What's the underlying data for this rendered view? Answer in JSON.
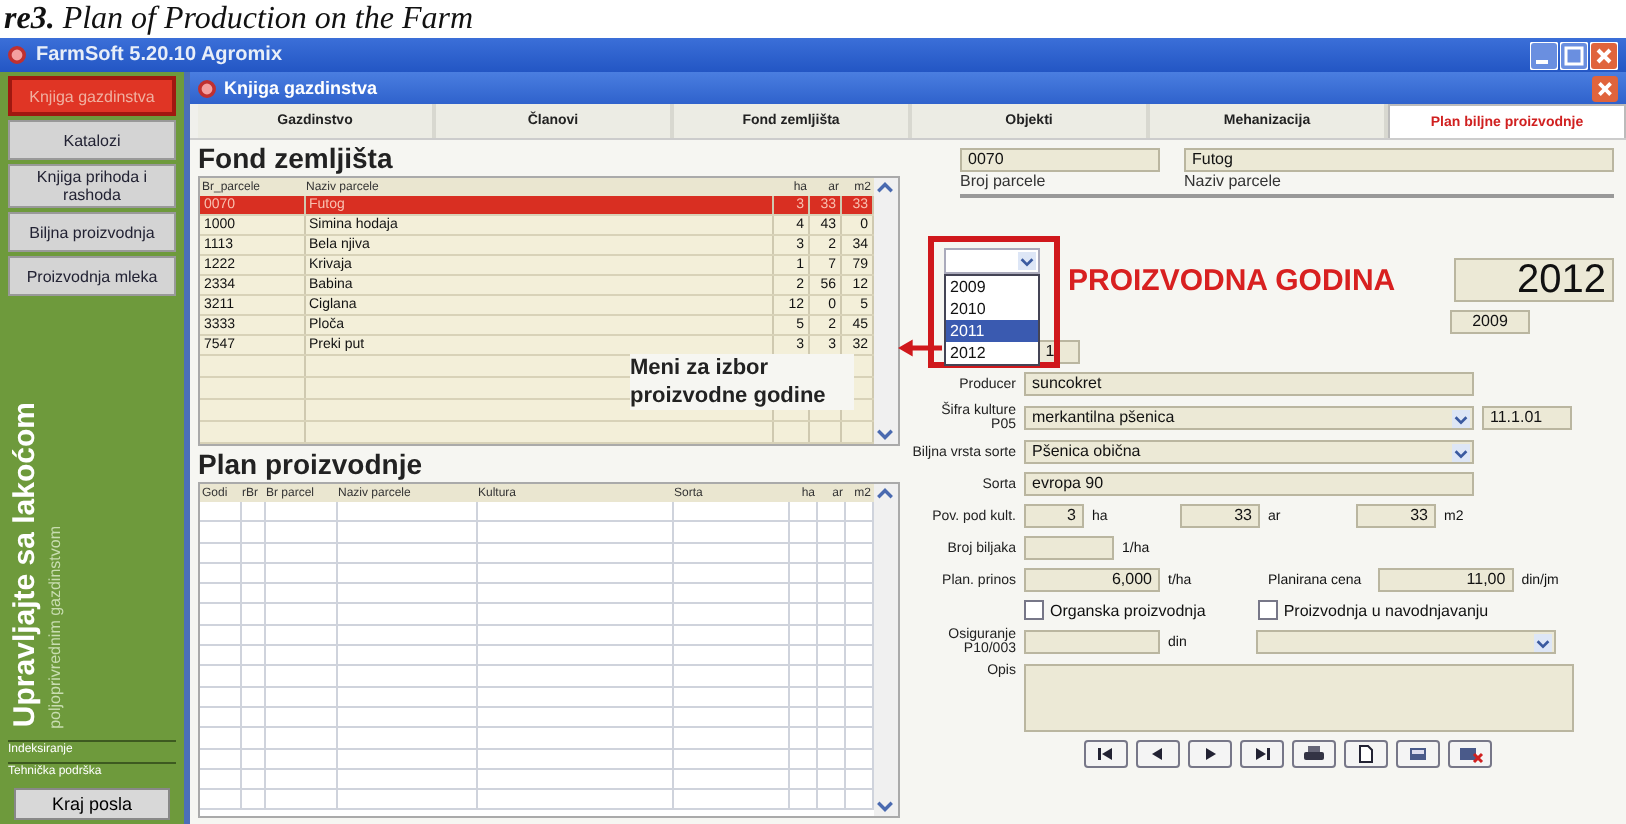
{
  "caption": "**re3.** Plan of Production on the Farm",
  "window": {
    "title": "FarmSoft 5.20.10 Agromix"
  },
  "sidebar": {
    "items": [
      {
        "label": "Knjiga gazdinstva",
        "selected": true
      },
      {
        "label": "Katalozi",
        "selected": false
      },
      {
        "label": "Knjiga prihoda i rashoda",
        "selected": false
      },
      {
        "label": "Biljna proizvodnja",
        "selected": false
      },
      {
        "label": "Proizvodnja mleka",
        "selected": false
      }
    ],
    "slogan": "Upravljajte sa lakoćom",
    "slogan_sub": "poljoprivrednim gazdinstvom",
    "links": [
      "Indeksiranje",
      "Tehnička podrška"
    ],
    "exit_button": "Kraj posla"
  },
  "subwindow": {
    "title": "Knjiga gazdinstva"
  },
  "tabs": [
    {
      "label": "Gazdinstvo",
      "selected": false
    },
    {
      "label": "Članovi",
      "selected": false
    },
    {
      "label": "Fond zemljišta",
      "selected": false
    },
    {
      "label": "Objekti",
      "selected": false
    },
    {
      "label": "Mehanizacija",
      "selected": false
    },
    {
      "label": "Plan biljne proizvodnje",
      "selected": true
    }
  ],
  "land_fund": {
    "heading": "Fond zemljišta",
    "columns": [
      "Br_parcele",
      "Naziv parcele",
      "ha",
      "ar",
      "m2"
    ],
    "rows": [
      {
        "cells": [
          "0070",
          "Futog",
          "3",
          "33",
          "33"
        ],
        "selected": true
      },
      {
        "cells": [
          "1000",
          "Simina hodaja",
          "4",
          "43",
          "0"
        ],
        "selected": false
      },
      {
        "cells": [
          "1113",
          "Bela njiva",
          "3",
          "2",
          "34"
        ],
        "selected": false
      },
      {
        "cells": [
          "1222",
          "Krivaja",
          "1",
          "7",
          "79"
        ],
        "selected": false
      },
      {
        "cells": [
          "2334",
          "Babina",
          "2",
          "56",
          "12"
        ],
        "selected": false
      },
      {
        "cells": [
          "3211",
          "Ciglana",
          "12",
          "0",
          "5"
        ],
        "selected": false
      },
      {
        "cells": [
          "3333",
          "Ploča",
          "5",
          "2",
          "45"
        ],
        "selected": false
      },
      {
        "cells": [
          "7547",
          "Preki put",
          "3",
          "3",
          "32"
        ],
        "selected": false
      }
    ]
  },
  "plan": {
    "heading": "Plan proizvodnje",
    "columns": [
      "Godi",
      "rBr",
      "Br parcel",
      "Naziv parcele",
      "Kultura",
      "Sorta",
      "ha",
      "ar",
      "m2"
    ]
  },
  "annotation": "Meni za izbor proizvodne godine",
  "form": {
    "parcel_number": {
      "value": "0070",
      "label": "Broj parcele"
    },
    "parcel_name": {
      "value": "Futog",
      "label": "Naziv parcele"
    },
    "year_options": [
      {
        "label": "2009",
        "selected": false
      },
      {
        "label": "2010",
        "selected": false
      },
      {
        "label": "2011",
        "selected": true
      },
      {
        "label": "2012",
        "selected": false
      }
    ],
    "year_heading": "PROIZVODNA GODINA",
    "year_value": "2012",
    "year_from": "2009",
    "number_value": "1",
    "producer": {
      "label": "Producer",
      "value": "suncokret"
    },
    "culture": {
      "label": "Šifra kulture",
      "sublabel": "P05",
      "value": "merkantilna pšenica",
      "code": "11.1.01"
    },
    "variety": {
      "label": "Biljna vrsta sorte",
      "value": "Pšenica obična"
    },
    "sort": {
      "label": "Sorta",
      "value": "evropa 90"
    },
    "area": {
      "label": "Pov. pod kult.",
      "ha": "3",
      "ha_unit": "ha",
      "ar": "33",
      "ar_unit": "ar",
      "m2": "33",
      "m2_unit": "m2"
    },
    "plants": {
      "label": "Broj biljaka",
      "unit": "1/ha"
    },
    "yield": {
      "label": "Plan. prinos",
      "value": "6,000",
      "unit": "t/ha"
    },
    "price": {
      "label": "Planirana cena",
      "value": "11,00",
      "unit": "din/jm"
    },
    "checkboxes": [
      {
        "label": "Organska proizvodnja",
        "checked": false
      },
      {
        "label": "Proizvodnja u navodnjavanju",
        "checked": false
      }
    ],
    "insurance": {
      "label": "Osiguranje",
      "sublabel": "P10/003",
      "unit": "din"
    },
    "description": {
      "label": "Opis"
    }
  }
}
